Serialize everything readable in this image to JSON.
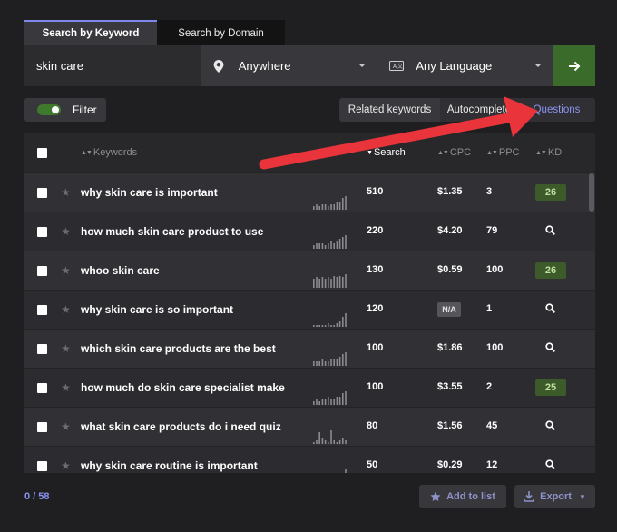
{
  "tabs": [
    {
      "label": "Search by Keyword",
      "active": true
    },
    {
      "label": "Search by Domain",
      "active": false
    }
  ],
  "search": {
    "value": "skin care",
    "location": "Anywhere",
    "language": "Any Language"
  },
  "filter": {
    "label": "Filter",
    "enabled": true
  },
  "modes": [
    "Related keywords",
    "Autocomplete",
    "Questions"
  ],
  "active_mode": "Questions",
  "table": {
    "headers": {
      "keywords": "Keywords",
      "search": "Search",
      "cpc": "CPC",
      "ppc": "PPC",
      "kd": "KD"
    },
    "rows": [
      {
        "keyword": "why skin care is important",
        "search": "510",
        "cpc": "$1.35",
        "ppc": "3",
        "kd": "26",
        "trend": [
          2,
          3,
          2,
          3,
          3,
          2,
          3,
          3,
          4,
          4,
          6,
          7
        ]
      },
      {
        "keyword": "how much skin care product to use",
        "search": "220",
        "cpc": "$4.20",
        "ppc": "79",
        "kd": "",
        "trend": [
          2,
          3,
          3,
          3,
          2,
          3,
          4,
          3,
          4,
          5,
          6,
          7
        ]
      },
      {
        "keyword": "whoo skin care",
        "search": "130",
        "cpc": "$0.59",
        "ppc": "100",
        "kd": "26",
        "trend": [
          6,
          7,
          6,
          7,
          6,
          7,
          6,
          8,
          7,
          8,
          7,
          9
        ]
      },
      {
        "keyword": "why skin care is so important",
        "search": "120",
        "cpc": "N/A",
        "ppc": "1",
        "kd": "",
        "trend": [
          1,
          1,
          1,
          1,
          1,
          2,
          1,
          1,
          2,
          3,
          5,
          7
        ]
      },
      {
        "keyword": "which skin care products are the best",
        "search": "100",
        "cpc": "$1.86",
        "ppc": "100",
        "kd": "",
        "trend": [
          2,
          2,
          2,
          3,
          2,
          2,
          3,
          3,
          3,
          4,
          5,
          6
        ]
      },
      {
        "keyword": "how much do skin care specialist make",
        "search": "100",
        "cpc": "$3.55",
        "ppc": "2",
        "kd": "25",
        "trend": [
          2,
          3,
          2,
          3,
          3,
          4,
          3,
          3,
          4,
          4,
          6,
          7
        ]
      },
      {
        "keyword": "what skin care products do i need quiz",
        "search": "80",
        "cpc": "$1.56",
        "ppc": "45",
        "kd": "",
        "trend": [
          1,
          2,
          6,
          3,
          2,
          1,
          7,
          2,
          1,
          2,
          3,
          2
        ]
      },
      {
        "keyword": "why skin care routine is important",
        "search": "50",
        "cpc": "$0.29",
        "ppc": "12",
        "kd": "",
        "trend": [
          1,
          1,
          1,
          1,
          1,
          1,
          1,
          1,
          1,
          2,
          3,
          5
        ]
      }
    ]
  },
  "footer": {
    "count": "0 / 58",
    "add_label": "Add to list",
    "export_label": "Export"
  },
  "colors": {
    "accent": "#7e87ea",
    "go_button": "#3a6b2a",
    "kd_badge": "#3c5a2a",
    "arrow": "#e8343a"
  }
}
